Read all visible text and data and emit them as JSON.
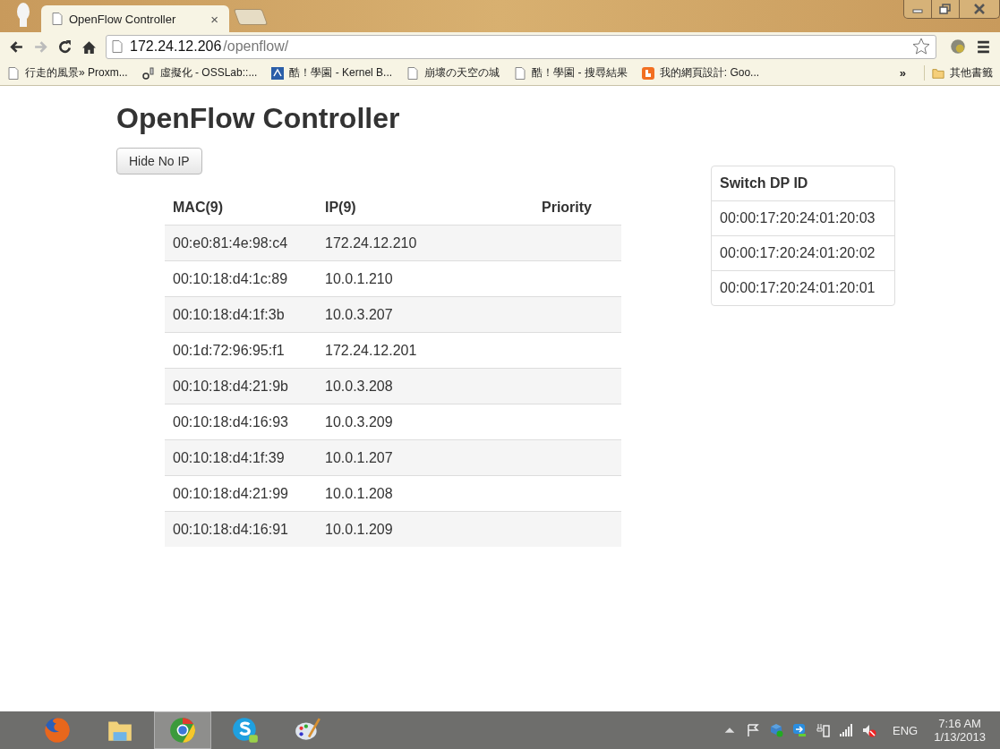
{
  "browser": {
    "tab_title": "OpenFlow Controller",
    "tab_close": "×",
    "url_host": "172.24.12.206",
    "url_path": "/openflow/",
    "bookmarks": [
      {
        "label": "行走的風景» Proxm...",
        "kind": "page"
      },
      {
        "label": "虛擬化 - OSSLab::...",
        "kind": "site"
      },
      {
        "label": "酷！學園 - Kernel B...",
        "kind": "site2"
      },
      {
        "label": "崩壞の天空の城",
        "kind": "page"
      },
      {
        "label": "酷！學園 - 搜尋結果",
        "kind": "page"
      },
      {
        "label": "我的網頁設計: Goo...",
        "kind": "blog"
      }
    ],
    "bookmarks_more": "»",
    "other_bookmarks": "其他書籤"
  },
  "page": {
    "title": "OpenFlow Controller",
    "hide_button": "Hide No IP",
    "hosts": {
      "columns": [
        "MAC(9)",
        "IP(9)",
        "Priority"
      ],
      "rows": [
        [
          "00:e0:81:4e:98:c4",
          "172.24.12.210"
        ],
        [
          "00:10:18:d4:1c:89",
          "10.0.1.210"
        ],
        [
          "00:10:18:d4:1f:3b",
          "10.0.3.207"
        ],
        [
          "00:1d:72:96:95:f1",
          "172.24.12.201"
        ],
        [
          "00:10:18:d4:21:9b",
          "10.0.3.208"
        ],
        [
          "00:10:18:d4:16:93",
          "10.0.3.209"
        ],
        [
          "00:10:18:d4:1f:39",
          "10.0.1.207"
        ],
        [
          "00:10:18:d4:21:99",
          "10.0.1.208"
        ],
        [
          "00:10:18:d4:16:91",
          "10.0.1.209"
        ]
      ]
    },
    "switches": {
      "heading": "Switch DP ID",
      "rows": [
        "00:00:17:20:24:01:20:03",
        "00:00:17:20:24:01:20:02",
        "00:00:17:20:24:01:20:01"
      ]
    }
  },
  "taskbar": {
    "apps": [
      {
        "kind": "firefox",
        "selected": false
      },
      {
        "kind": "folder",
        "selected": false
      },
      {
        "kind": "chrome",
        "selected": true
      },
      {
        "kind": "skype",
        "selected": false
      },
      {
        "kind": "paint",
        "selected": false
      }
    ],
    "language": "ENG",
    "time": "7:16 AM",
    "date": "1/13/2013"
  }
}
